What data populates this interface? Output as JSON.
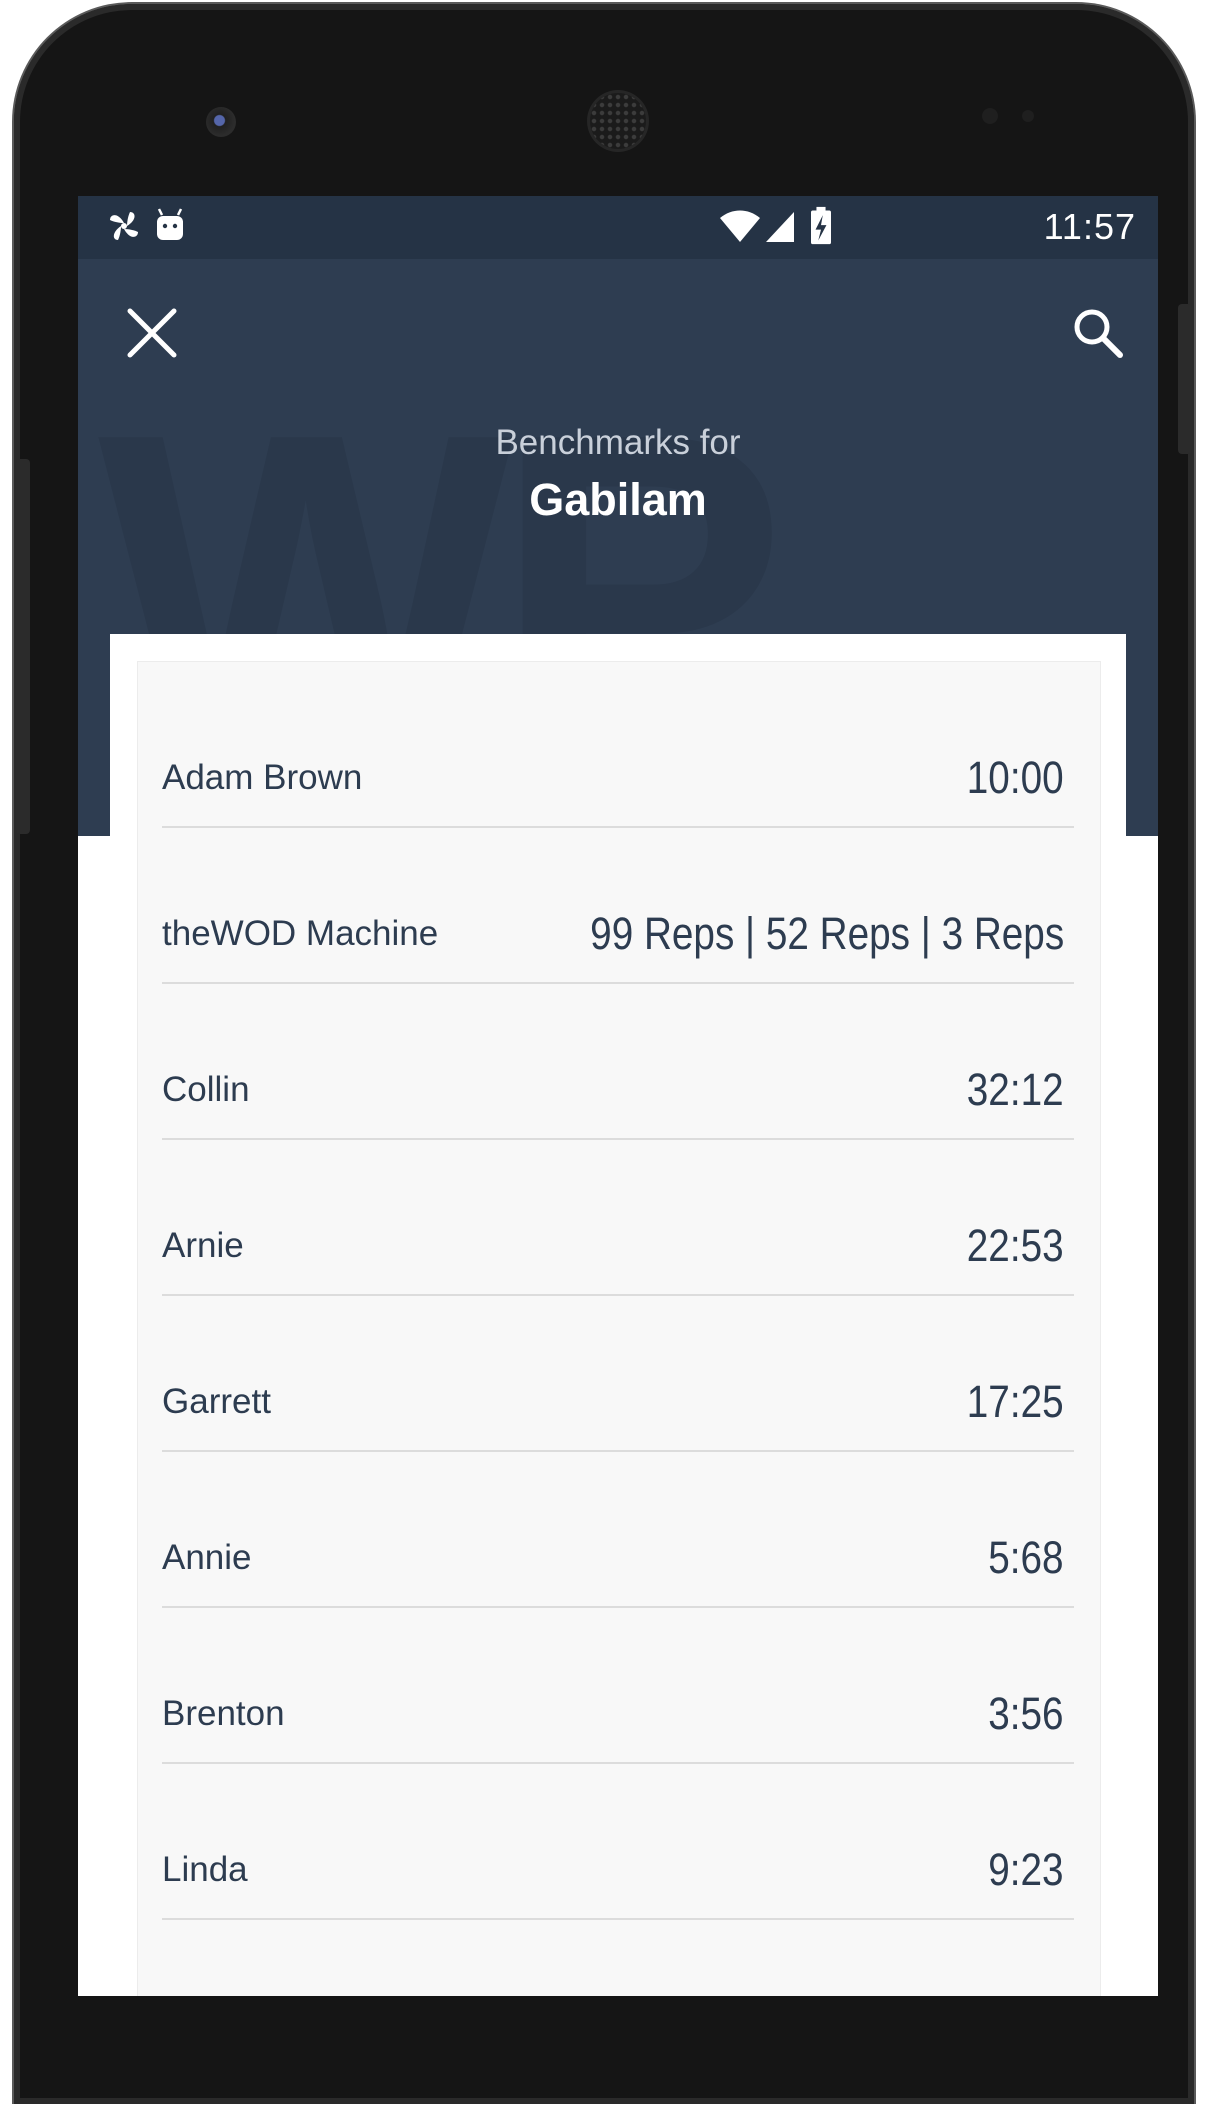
{
  "status_bar": {
    "time": "11:57",
    "icons": [
      "pinwheel-icon",
      "android-icon",
      "wifi-icon",
      "signal-icon",
      "battery-charging-icon"
    ]
  },
  "header": {
    "close_icon": "close-icon",
    "search_icon": "search-icon",
    "subtitle": "Benchmarks for",
    "title": "Gabilam"
  },
  "benchmarks": [
    {
      "name": "Adam Brown",
      "value": "10:00"
    },
    {
      "name": "theWOD Machine",
      "value": "99 Reps | 52 Reps | 3 Reps"
    },
    {
      "name": "Collin",
      "value": "32:12"
    },
    {
      "name": "Arnie",
      "value": "22:53"
    },
    {
      "name": "Garrett",
      "value": "17:25"
    },
    {
      "name": "Annie",
      "value": "5:68"
    },
    {
      "name": "Brenton",
      "value": "3:56"
    },
    {
      "name": "Linda",
      "value": "9:23"
    }
  ],
  "colors": {
    "status_bar": "#253345",
    "header": "#2e3d51",
    "text": "#2d3c50",
    "card": "#f8f8f8"
  }
}
